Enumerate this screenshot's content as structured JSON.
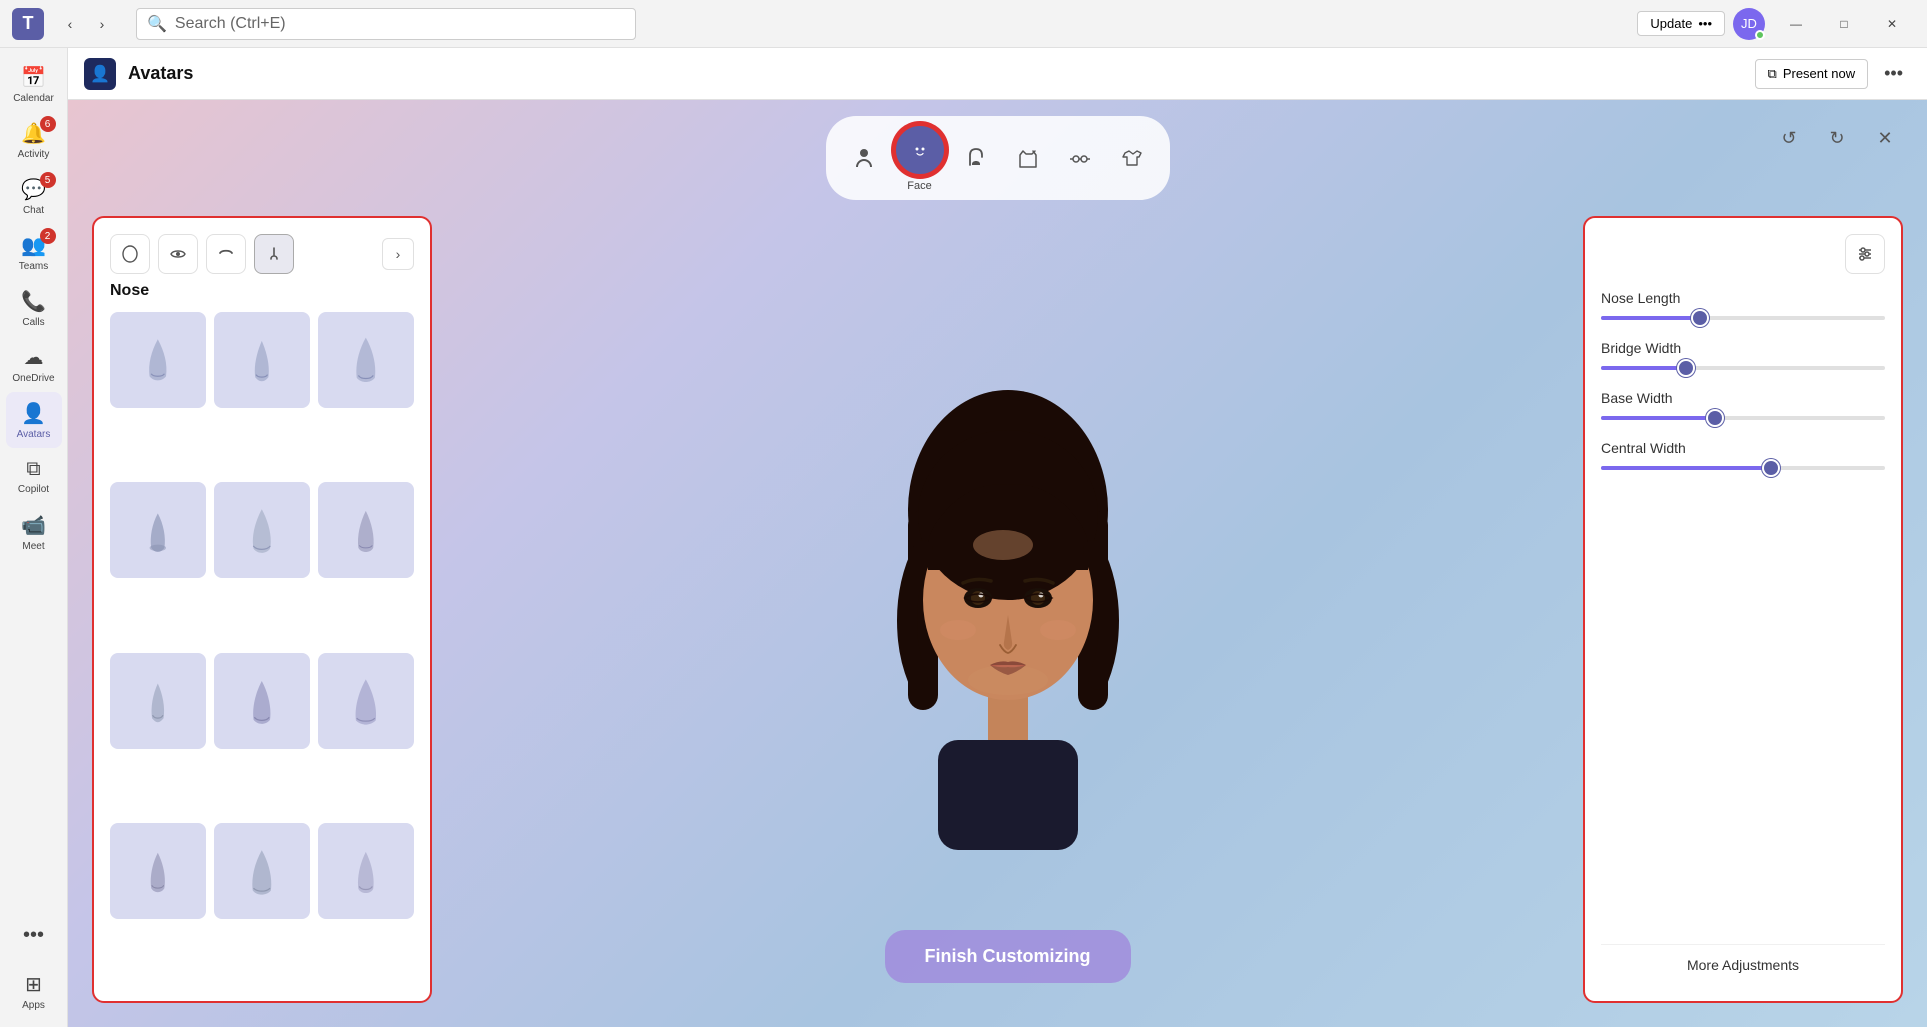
{
  "titlebar": {
    "logo": "T",
    "search_placeholder": "Search (Ctrl+E)",
    "update_label": "Update",
    "update_dots": "•••",
    "minimize": "—",
    "maximize": "□",
    "close": "✕"
  },
  "sidebar": {
    "items": [
      {
        "id": "calendar",
        "label": "Calendar",
        "icon": "📅",
        "badge": null,
        "active": false
      },
      {
        "id": "activity",
        "label": "Activity",
        "icon": "🔔",
        "badge": "6",
        "active": false
      },
      {
        "id": "chat",
        "label": "Chat",
        "icon": "💬",
        "badge": "5",
        "active": false
      },
      {
        "id": "teams",
        "label": "Teams",
        "icon": "👥",
        "badge": "2",
        "active": false
      },
      {
        "id": "calls",
        "label": "Calls",
        "icon": "📞",
        "badge": null,
        "active": false
      },
      {
        "id": "onedrive",
        "label": "OneDrive",
        "icon": "☁",
        "badge": null,
        "active": false
      },
      {
        "id": "avatars",
        "label": "Avatars",
        "icon": "👤",
        "badge": null,
        "active": true
      },
      {
        "id": "copilot",
        "label": "Copilot",
        "icon": "⧉",
        "badge": null,
        "active": false
      },
      {
        "id": "meet",
        "label": "Meet",
        "icon": "📹",
        "badge": null,
        "active": false
      },
      {
        "id": "more",
        "label": "...",
        "icon": "•••",
        "badge": null,
        "active": false
      },
      {
        "id": "apps",
        "label": "Apps",
        "icon": "⊞",
        "badge": null,
        "active": false
      }
    ]
  },
  "header": {
    "app_icon": "👤",
    "title": "Avatars",
    "present_now": "Present now",
    "more_dots": "•••"
  },
  "toolbar": {
    "tabs": [
      {
        "id": "body",
        "icon": "🧍",
        "label": "",
        "active": false
      },
      {
        "id": "face",
        "icon": "😊",
        "label": "Face",
        "active": true
      },
      {
        "id": "hair",
        "icon": "💆",
        "label": "",
        "active": false
      },
      {
        "id": "outfit",
        "icon": "👔",
        "label": "",
        "active": false
      },
      {
        "id": "accessories",
        "icon": "🕶",
        "label": "",
        "active": false
      },
      {
        "id": "clothing",
        "icon": "👕",
        "label": "",
        "active": false
      }
    ],
    "undo_icon": "↺",
    "redo_icon": "↻",
    "close_icon": "✕"
  },
  "left_panel": {
    "tabs": [
      {
        "id": "face-shape",
        "icon": "😐"
      },
      {
        "id": "eyes",
        "icon": "👁"
      },
      {
        "id": "eyebrows",
        "icon": "〰"
      },
      {
        "id": "nose",
        "icon": "△",
        "active": true
      }
    ],
    "section_title": "Nose",
    "nose_items": [
      1,
      2,
      3,
      4,
      5,
      6,
      7,
      8,
      9,
      10,
      11,
      12
    ],
    "next_arrow": "›"
  },
  "right_panel": {
    "sliders": [
      {
        "id": "nose-length",
        "label": "Nose Length",
        "value": 35
      },
      {
        "id": "bridge-width",
        "label": "Bridge Width",
        "value": 30
      },
      {
        "id": "base-width",
        "label": "Base Width",
        "value": 40
      },
      {
        "id": "central-width",
        "label": "Central Width",
        "value": 60
      }
    ],
    "more_adjustments": "More Adjustments"
  },
  "finish_btn": "Finish Customizing"
}
